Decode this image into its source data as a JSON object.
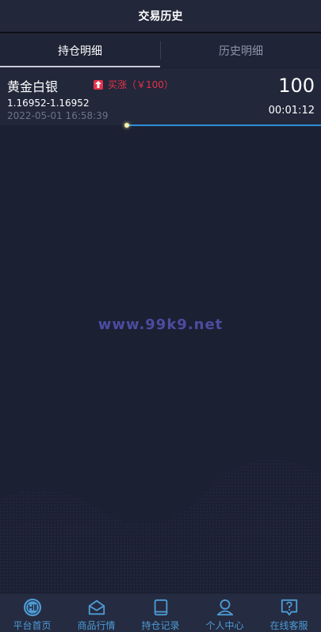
{
  "header": {
    "title": "交易历史"
  },
  "tabs": [
    {
      "label": "持仓明细",
      "active": true
    },
    {
      "label": "历史明细",
      "active": false
    }
  ],
  "position": {
    "name": "黄金白银",
    "direction": "买涨（￥100）",
    "price_range": "1.16952-1.16952",
    "timestamp": "2022-05-01 16:58:39",
    "amount": "100",
    "countdown": "00:01:12"
  },
  "watermark": "www.99k9.net",
  "bottom_nav": [
    {
      "label": "平台首页",
      "icon": "home-logo-icon"
    },
    {
      "label": "商品行情",
      "icon": "envelope-icon"
    },
    {
      "label": "持仓记录",
      "icon": "document-icon"
    },
    {
      "label": "个人中心",
      "icon": "user-icon"
    },
    {
      "label": "在线客服",
      "icon": "help-chat-icon"
    }
  ],
  "colors": {
    "background": "#1c2033",
    "accent": "#4d9bd6",
    "rise": "#e5324a",
    "progress": "#2d8fd7"
  }
}
